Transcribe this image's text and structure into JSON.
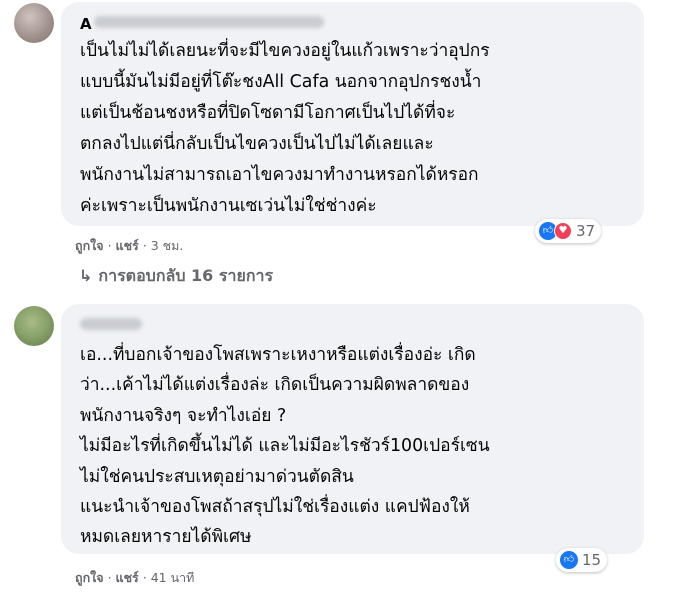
{
  "comments": [
    {
      "author_initial": "A",
      "lines": [
        "เป็นไม่ไม่ได้เลยนะที่จะมีไขควงอยู่ในแก้วเพราะว่าอุปกร",
        "แบบนี้มันไม่มีอยู่ที่โต๊ะชงAll Cafa นอกจากอุปกรชงน้ำ",
        "แต่เป็นช้อนชงหรือที่ปิดโซดามีโอกาศเป็นไปได้ที่จะ",
        "ตกลงไปแต่นี่กลับเป็นไขควงเป็นไปไม่ได้เลยและ",
        "พนักงานไม่สามารถเอาไขควงมาทำงานหรอกได้หรอก",
        "ค่ะเพราะเป็นพนักงานเซเว่นไม่ใช่ช่างค่ะ"
      ],
      "reaction_count": "37",
      "like_label": "ถูกใจ",
      "share_label": "แชร์",
      "time": "3 ชม."
    },
    {
      "author_initial": "",
      "lines": [
        "เอ...ที่บอกเจ้าของโพสเพราะเหงาหรือแต่งเรื่องอ่ะ เกิด",
        "ว่า...เค้าไม่ได้แต่งเรื่องล่ะ เกิดเป็นความผิดพลาดของ",
        "พนักงานจริงๆ จะทำไงเอ่ย ?",
        "ไม่มีอะไรที่เกิดขึ้นไม่ได้ และไม่มีอะไรชัวร์100เปอร์เซน",
        "ไม่ใช่คนประสบเหตุอย่ามาด่วนตัดสิน",
        "แนะนำเจ้าของโพสถ้าสรุปไม่ใช่เรื่องแต่ง แคปฟ้องให้",
        "หมดเลยหารายได้พิเศษ"
      ],
      "reaction_count": "15",
      "like_label": "ถูกใจ",
      "share_label": "แชร์",
      "time": "41 นาที"
    }
  ],
  "replies_label": "การตอบกลับ 16 รายการ",
  "icons": {
    "reply_arrow": "reply-arrow-icon",
    "like": "like-icon",
    "love": "love-icon"
  },
  "colors": {
    "bubble": "#f0f2f5",
    "like": "#1877f2",
    "love": "#f33e58",
    "secondary_text": "#65676b"
  }
}
